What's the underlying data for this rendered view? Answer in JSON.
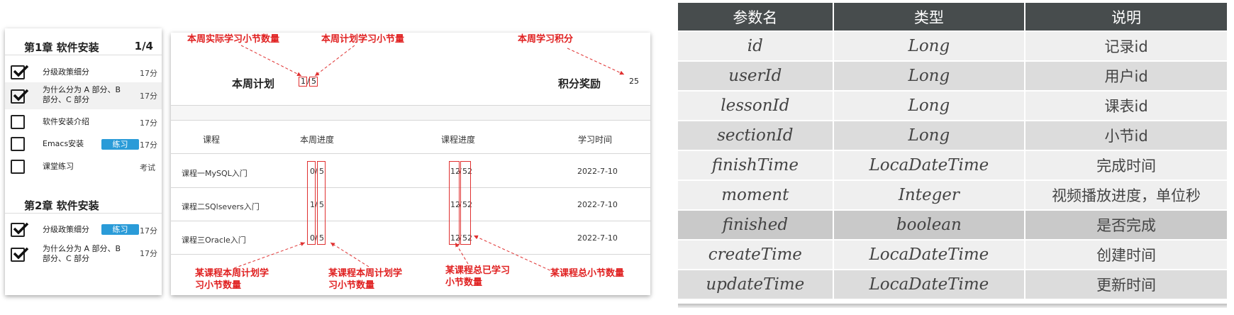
{
  "chapters": [
    {
      "title": "第1章 软件安装",
      "count": "1/4",
      "sections": [
        {
          "name": "分级政策细分",
          "checked": true,
          "badge": "",
          "right": "17分",
          "highlight": false
        },
        {
          "name": "为什么分为 A 部分、B 部分、C 部分",
          "checked": true,
          "badge": "",
          "right": "17分",
          "highlight": true
        },
        {
          "name": "软件安装介绍",
          "checked": false,
          "badge": "",
          "right": "17分",
          "highlight": false
        },
        {
          "name": "Emacs安装",
          "checked": false,
          "badge": "练习",
          "right": "17分",
          "highlight": false
        },
        {
          "name": "课堂练习",
          "checked": false,
          "badge": "",
          "right": "考试",
          "highlight": false
        }
      ]
    },
    {
      "title": "第2章 软件安装",
      "count": "",
      "sections": [
        {
          "name": "分级政策细分",
          "checked": true,
          "badge": "练习",
          "right": "17分",
          "highlight": false
        },
        {
          "name": "为什么分为 A 部分、B 部分、C 部分",
          "checked": true,
          "badge": "",
          "right": "17分",
          "highlight": false
        }
      ]
    }
  ],
  "weekly": {
    "plan_label": "本周计划",
    "plan_actual": "1",
    "plan_total": "5",
    "points_label": "积分奖励",
    "points_value": "25",
    "headers": [
      "课程",
      "本周进度",
      "课程进度",
      "学习时间"
    ],
    "rows": [
      {
        "course": "课程一MySQL入门",
        "week_done": "0",
        "week_plan": "5",
        "done": "12",
        "total": "52",
        "date": "2022-7-10"
      },
      {
        "course": "课程二SQlsevers入门",
        "week_done": "1",
        "week_plan": "5",
        "done": "12",
        "total": "52",
        "date": "2022-7-10"
      },
      {
        "course": "课程三Oracle入门",
        "week_done": "0",
        "week_plan": "5",
        "done": "12",
        "total": "52",
        "date": "2022-7-10"
      }
    ],
    "annotations": {
      "actual_sections": "本周实际学习小节数量",
      "planned_sections": "本周计划学习小节量",
      "weekly_points": "本周学习积分",
      "course_week_plan": "某课程本周计划学习小节数量",
      "course_week_planned_count": "某课程本周计划学习小节数量",
      "course_total_learned": "某课程总已学习小节数量",
      "course_total_sections": "某课程总小节数量"
    }
  },
  "param_table": {
    "headers": [
      "参数名",
      "类型",
      "说明"
    ],
    "rows": [
      {
        "name": "id",
        "type": "Long",
        "desc": "记录id"
      },
      {
        "name": "userId",
        "type": "Long",
        "desc": "用户id"
      },
      {
        "name": "lessonId",
        "type": "Long",
        "desc": "课表id"
      },
      {
        "name": "sectionId",
        "type": "Long",
        "desc": "小节id"
      },
      {
        "name": "finishTime",
        "type": "LocaDateTime",
        "desc": "完成时间"
      },
      {
        "name": "moment",
        "type": "Integer",
        "desc": "视频播放进度，单位秒"
      },
      {
        "name": "finished",
        "type": "boolean",
        "desc": "是否完成"
      },
      {
        "name": "createTime",
        "type": "LocaDateTime",
        "desc": "创建时间"
      },
      {
        "name": "updateTime",
        "type": "LocaDateTime",
        "desc": "更新时间"
      }
    ]
  },
  "colors": {
    "accent_red": "#e02020",
    "badge_blue": "#2a9bd8",
    "table_header": "#474c4d"
  }
}
